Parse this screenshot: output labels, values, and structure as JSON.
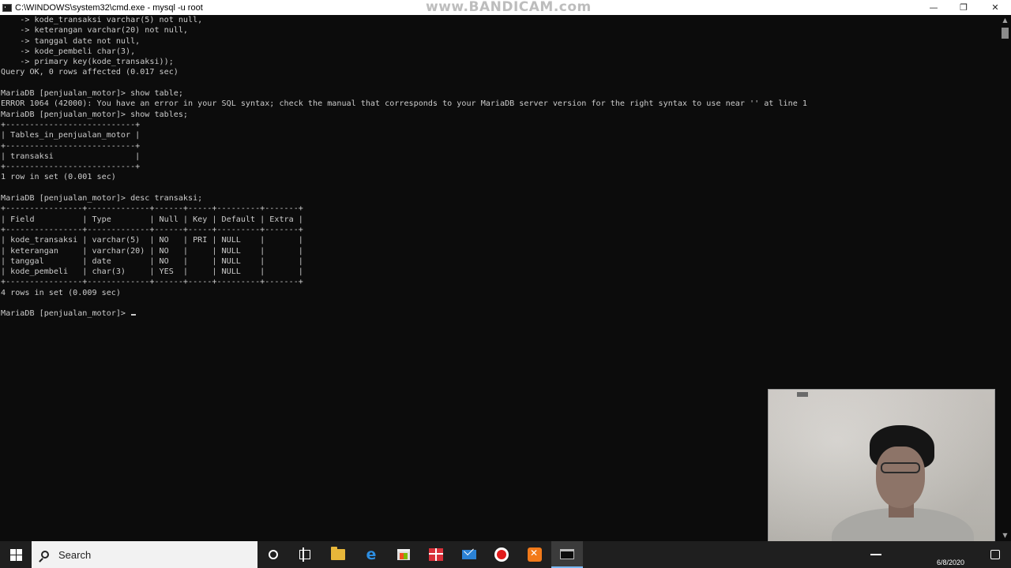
{
  "window": {
    "title": "C:\\WINDOWS\\system32\\cmd.exe - mysql  -u root",
    "watermark": "www.BANDICAM.com",
    "icon": "cmd-icon"
  },
  "console": {
    "lines": [
      "    -> kode_transaksi varchar(5) not null,",
      "    -> keterangan varchar(20) not null,",
      "    -> tanggal date not null,",
      "    -> kode_pembeli char(3),",
      "    -> primary key(kode_transaksi));",
      "Query OK, 0 rows affected (0.017 sec)",
      "",
      "MariaDB [penjualan_motor]> show table;",
      "ERROR 1064 (42000): You have an error in your SQL syntax; check the manual that corresponds to your MariaDB server version for the right syntax to use near '' at line 1",
      "MariaDB [penjualan_motor]> show tables;",
      "+---------------------------+",
      "| Tables_in_penjualan_motor |",
      "+---------------------------+",
      "| transaksi                 |",
      "+---------------------------+",
      "1 row in set (0.001 sec)",
      "",
      "MariaDB [penjualan_motor]> desc transaksi;",
      "+----------------+-------------+------+-----+---------+-------+",
      "| Field          | Type        | Null | Key | Default | Extra |",
      "+----------------+-------------+------+-----+---------+-------+",
      "| kode_transaksi | varchar(5)  | NO   | PRI | NULL    |       |",
      "| keterangan     | varchar(20) | NO   |     | NULL    |       |",
      "| tanggal        | date        | NO   |     | NULL    |       |",
      "| kode_pembeli   | char(3)     | YES  |     | NULL    |       |",
      "+----------------+-------------+------+-----+---------+-------+",
      "4 rows in set (0.009 sec)",
      ""
    ],
    "prompt": "MariaDB [penjualan_motor]> "
  },
  "taskbar": {
    "search_label": "Search",
    "date": "6/8/2020",
    "apps": [
      "cortana-icon",
      "task-view-icon",
      "file-explorer-icon",
      "edge-icon",
      "store-icon",
      "gift-icon",
      "mail-icon",
      "record-icon",
      "xampp-icon",
      "cmd-icon"
    ]
  },
  "colors": {
    "console_bg": "#0c0c0c",
    "console_text": "#cccccc",
    "taskbar_bg": "#1f1f1f"
  }
}
